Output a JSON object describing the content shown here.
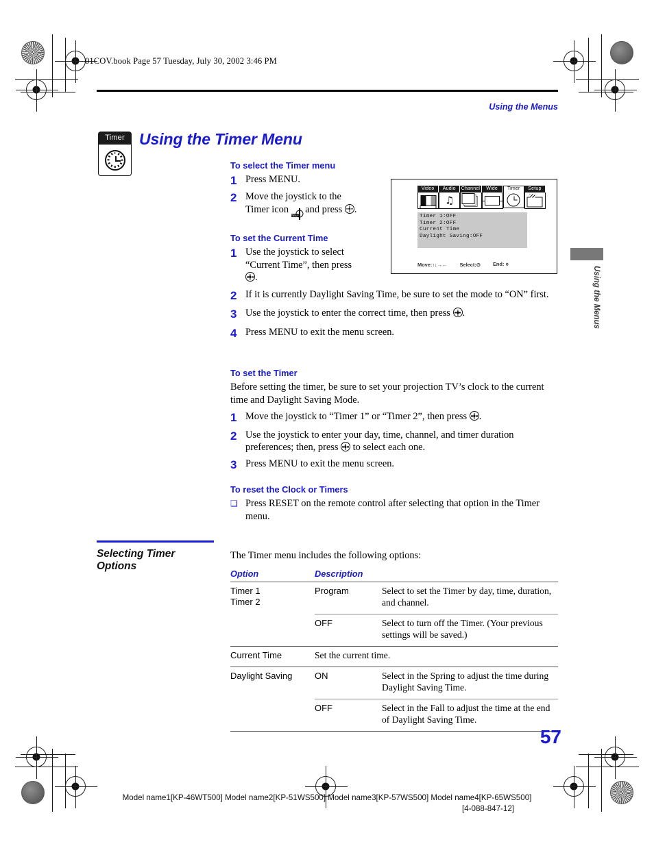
{
  "print_header": "01COV.book  Page 57  Tuesday, July 30, 2002  3:46 PM",
  "running_head": "Using the Menus",
  "chapter_icon_label": "Timer",
  "title": "Using the Timer Menu",
  "side_tab_label": "Using the Menus",
  "page_number": "57",
  "colors": {
    "accent_blue": "#1a1ad0",
    "osd_panel_gray": "#c9c9c9",
    "side_tab_gray": "#787878"
  },
  "sections": [
    {
      "heading": "To select the Timer menu",
      "steps": [
        {
          "num": "1",
          "text": "Press MENU."
        },
        {
          "num": "2",
          "text_a": "Move the joystick to the",
          "text_b": "Timer icon",
          "text_c": "and press",
          "text_d": "."
        }
      ]
    },
    {
      "heading": "To set the Current Time",
      "steps": [
        {
          "num": "1",
          "text_a": "Use the joystick to select",
          "text_b": "“Current Time”, then press",
          "text_c": "."
        },
        {
          "num": "2",
          "text": "If it is currently Daylight Saving Time, be sure to set the mode to “ON” first."
        },
        {
          "num": "3",
          "text_a": "Use the joystick to enter the correct time, then press",
          "text_b": "."
        },
        {
          "num": "4",
          "text": "Press MENU to exit the menu screen."
        }
      ]
    },
    {
      "heading": "To set the Timer",
      "intro": "Before setting the timer, be sure to set your projection TV’s clock to the current time and Daylight Saving Mode.",
      "steps": [
        {
          "num": "1",
          "text_a": "Move the joystick to “Timer 1” or “Timer 2”, then press",
          "text_b": "."
        },
        {
          "num": "2",
          "text_a": "Use the joystick to enter your day, time, channel, and timer duration preferences; then, press",
          "text_b": "to select each one."
        },
        {
          "num": "3",
          "text": "Press MENU to exit the menu screen."
        }
      ]
    },
    {
      "heading": "To reset the Clock or Timers",
      "bullet": "Press RESET on the remote control after selecting that option in the Timer menu."
    }
  ],
  "osd": {
    "tabs": [
      {
        "label": "Video",
        "icon": "video-icon",
        "selected": false
      },
      {
        "label": "Audio",
        "icon": "audio-note-icon",
        "selected": false
      },
      {
        "label": "Channel",
        "icon": "channel-cards-icon",
        "selected": false
      },
      {
        "label": "Wide",
        "icon": "wide-screen-icon",
        "selected": false
      },
      {
        "label": "Timer",
        "icon": "clock-icon",
        "selected": true
      },
      {
        "label": "Setup",
        "icon": "setup-icon",
        "selected": false
      }
    ],
    "items": [
      "Timer  1:OFF",
      "Timer  2:OFF",
      "Current Time",
      "Daylight Saving:OFF"
    ],
    "footer": {
      "move_label": "Move:",
      "move_glyph": "↑↓→←",
      "select_label": "Select:",
      "select_glyph": "⊙",
      "end_label": "End:",
      "end_glyph": "⌽"
    }
  },
  "options_section": {
    "heading_line1": "Selecting Timer",
    "heading_line2": "Options",
    "intro": "The Timer menu includes the following options:",
    "columns": [
      "Option",
      "Description"
    ],
    "rows": [
      {
        "option": "Timer 1\nTimer 2",
        "option_l1": "Timer 1",
        "option_l2": "Timer 2",
        "value": "Program",
        "description": "Select to set the Timer by day, time, duration, and channel."
      },
      {
        "option": "",
        "value": "OFF",
        "description": "Select to turn off the Timer. (Your previous settings will be saved.)"
      },
      {
        "option": "Current Time",
        "value": "Set the current time.",
        "description": ""
      },
      {
        "option": "Daylight Saving",
        "value": "ON",
        "description": "Select in the Spring to adjust the time during Daylight Saving Time."
      },
      {
        "option": "",
        "value": "OFF",
        "description": "Select in the Fall to adjust the time at the end of Daylight Saving Time."
      }
    ]
  },
  "footer": {
    "models": "Model name1[KP-46WT500] Model name2[KP-51WS500] Model name3[KP-57WS500] Model name4[KP-65WS500]",
    "doc_id": "[4-088-847-12]"
  }
}
